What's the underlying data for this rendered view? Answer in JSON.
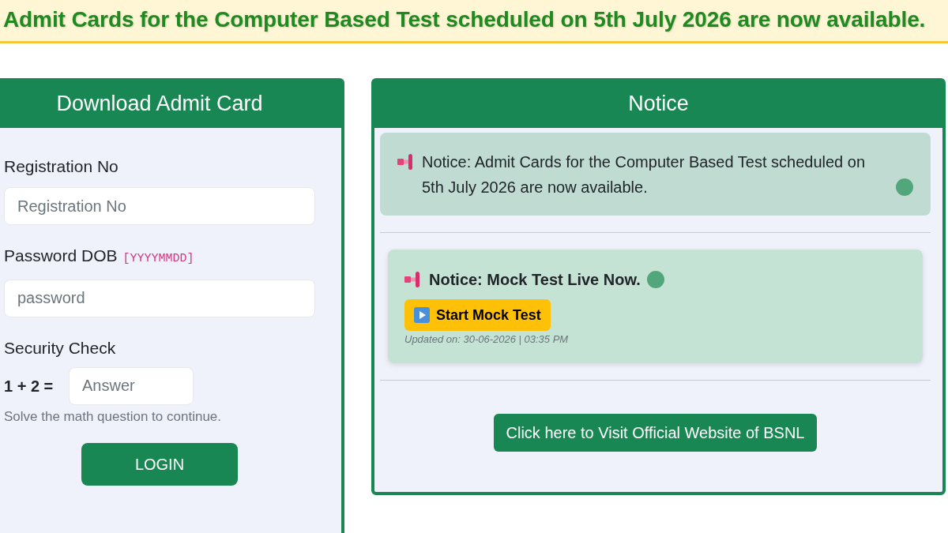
{
  "banner": {
    "text": "Admit Cards for the Computer Based Test scheduled on 5th July 2026 are now available."
  },
  "login_card": {
    "title": "Download Admit Card",
    "fields": [
      {
        "label": "Registration No",
        "placeholder": "Registration No"
      },
      {
        "label": "Password DOB",
        "hint": "[YYYYMMDD]",
        "placeholder": "password"
      }
    ],
    "security_check": {
      "label": "Security Check",
      "question": "1 + 2 =",
      "placeholder": "Answer",
      "help": "Solve the math question to continue."
    },
    "button": "LOGIN"
  },
  "notice_card": {
    "title": "Notice",
    "notices": [
      {
        "kind": "plain",
        "text": "Notice: Admit Cards for the Computer Based Test scheduled on 5th July 2026 are now available."
      },
      {
        "kind": "live",
        "text": "Notice: Mock Test Live Now.",
        "button": "Start Mock Test",
        "updated": "Updated on: 30-06-2026 | 03:35 PM"
      }
    ],
    "link_button": "Click here to Visit Official Website of BSNL"
  }
}
